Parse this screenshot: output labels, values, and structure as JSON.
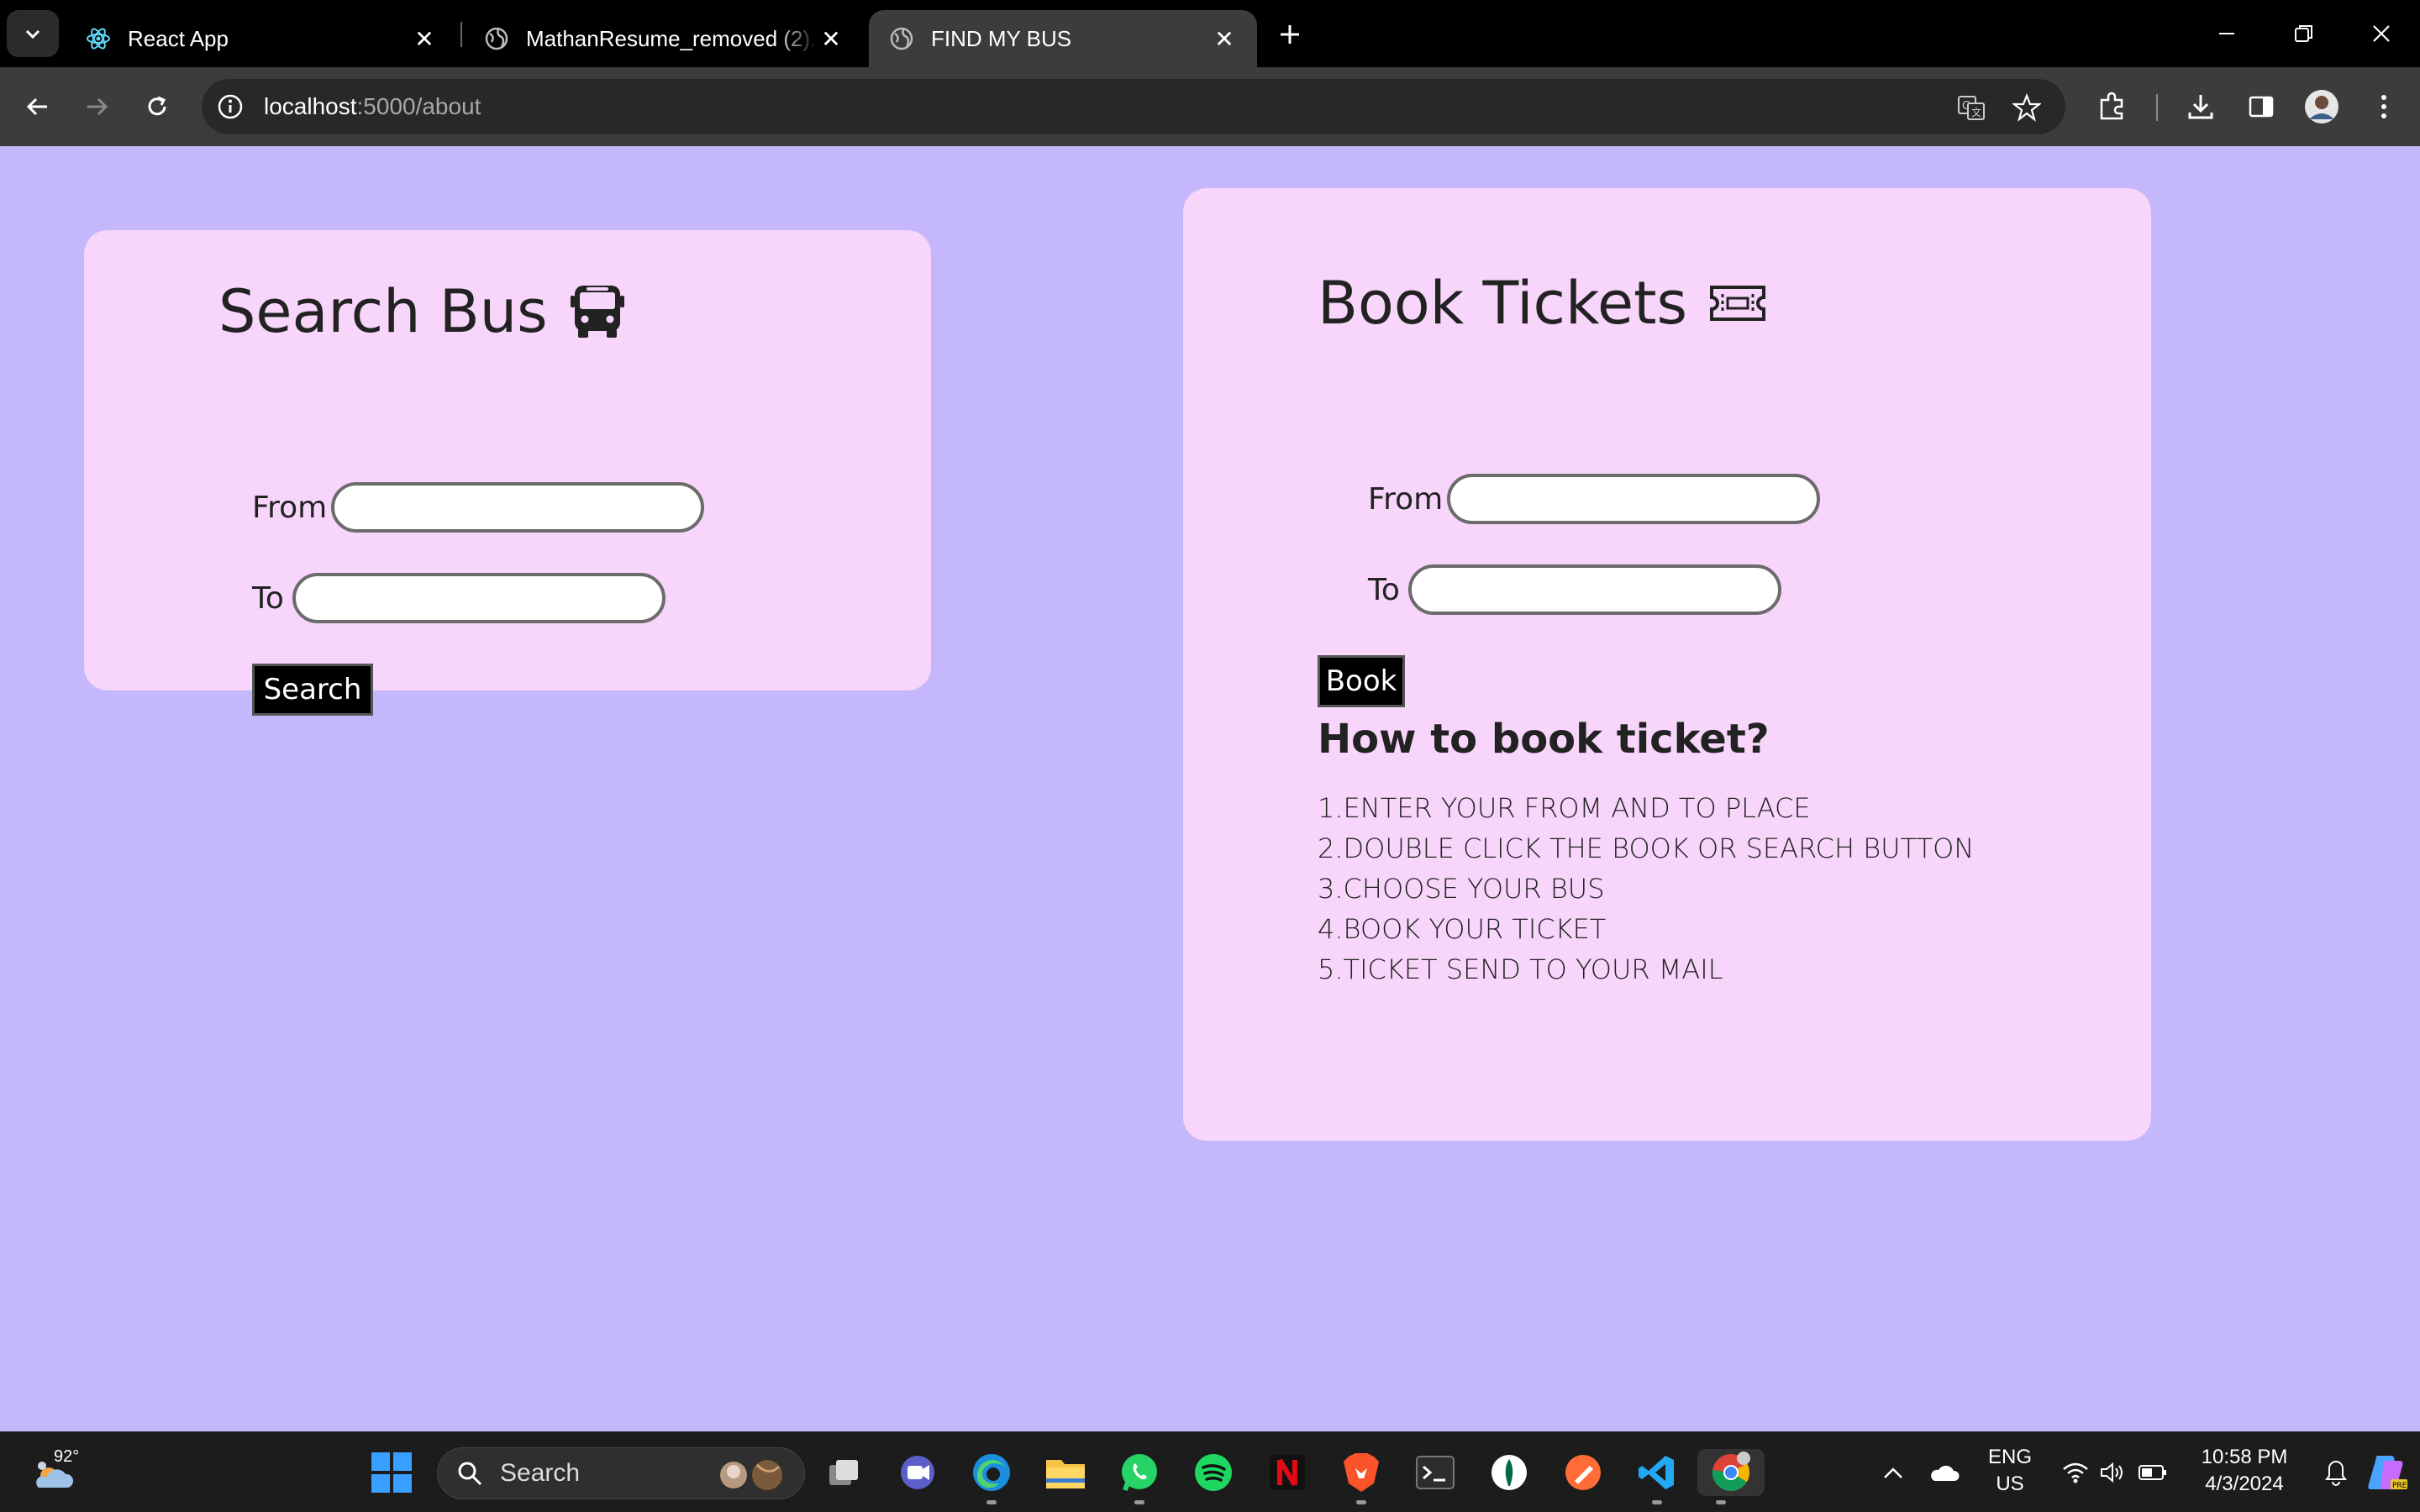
{
  "browser": {
    "tabs": [
      {
        "label": "React App",
        "icon": "react-icon"
      },
      {
        "label": "MathanResume_removed (2).pdf",
        "icon": "globe-icon"
      },
      {
        "label": "FIND MY BUS",
        "icon": "globe-icon",
        "active": true
      }
    ],
    "address": {
      "host": "localhost",
      "path": ":5000/about"
    }
  },
  "search_card": {
    "title": "Search Bus",
    "title_icon": "bus-icon",
    "from_label": "From",
    "to_label": "To",
    "from_value": "",
    "to_value": "",
    "button_label": "Search"
  },
  "book_card": {
    "title": "Book Tickets",
    "title_icon": "ticket-icon",
    "from_label": "From",
    "to_label": "To",
    "from_value": "",
    "to_value": "",
    "button_label": "Book",
    "howto_title": "How to book ticket?",
    "steps": [
      "1.ENTER YOUR FROM AND TO PLACE",
      "2.DOUBLE CLICK THE BOOK OR SEARCH BUTTON",
      "3.CHOOSE YOUR BUS",
      "4.BOOK YOUR TICKET",
      "5.TICKET SEND TO YOUR MAIL"
    ]
  },
  "taskbar": {
    "weather_temp": "92°",
    "search_label": "Search",
    "lang_line1": "ENG",
    "lang_line2": "US",
    "time": "10:58 PM",
    "date": "4/3/2024",
    "apps": [
      "task-view",
      "teams",
      "edge",
      "file-explorer",
      "whatsapp",
      "spotify",
      "netflix",
      "brave",
      "terminal",
      "mongodb-compass",
      "postman",
      "vscode",
      "chrome"
    ]
  },
  "colors": {
    "page_bg": "#c5b7fb",
    "card_bg": "#f8d5fb",
    "button_bg": "#000000"
  }
}
